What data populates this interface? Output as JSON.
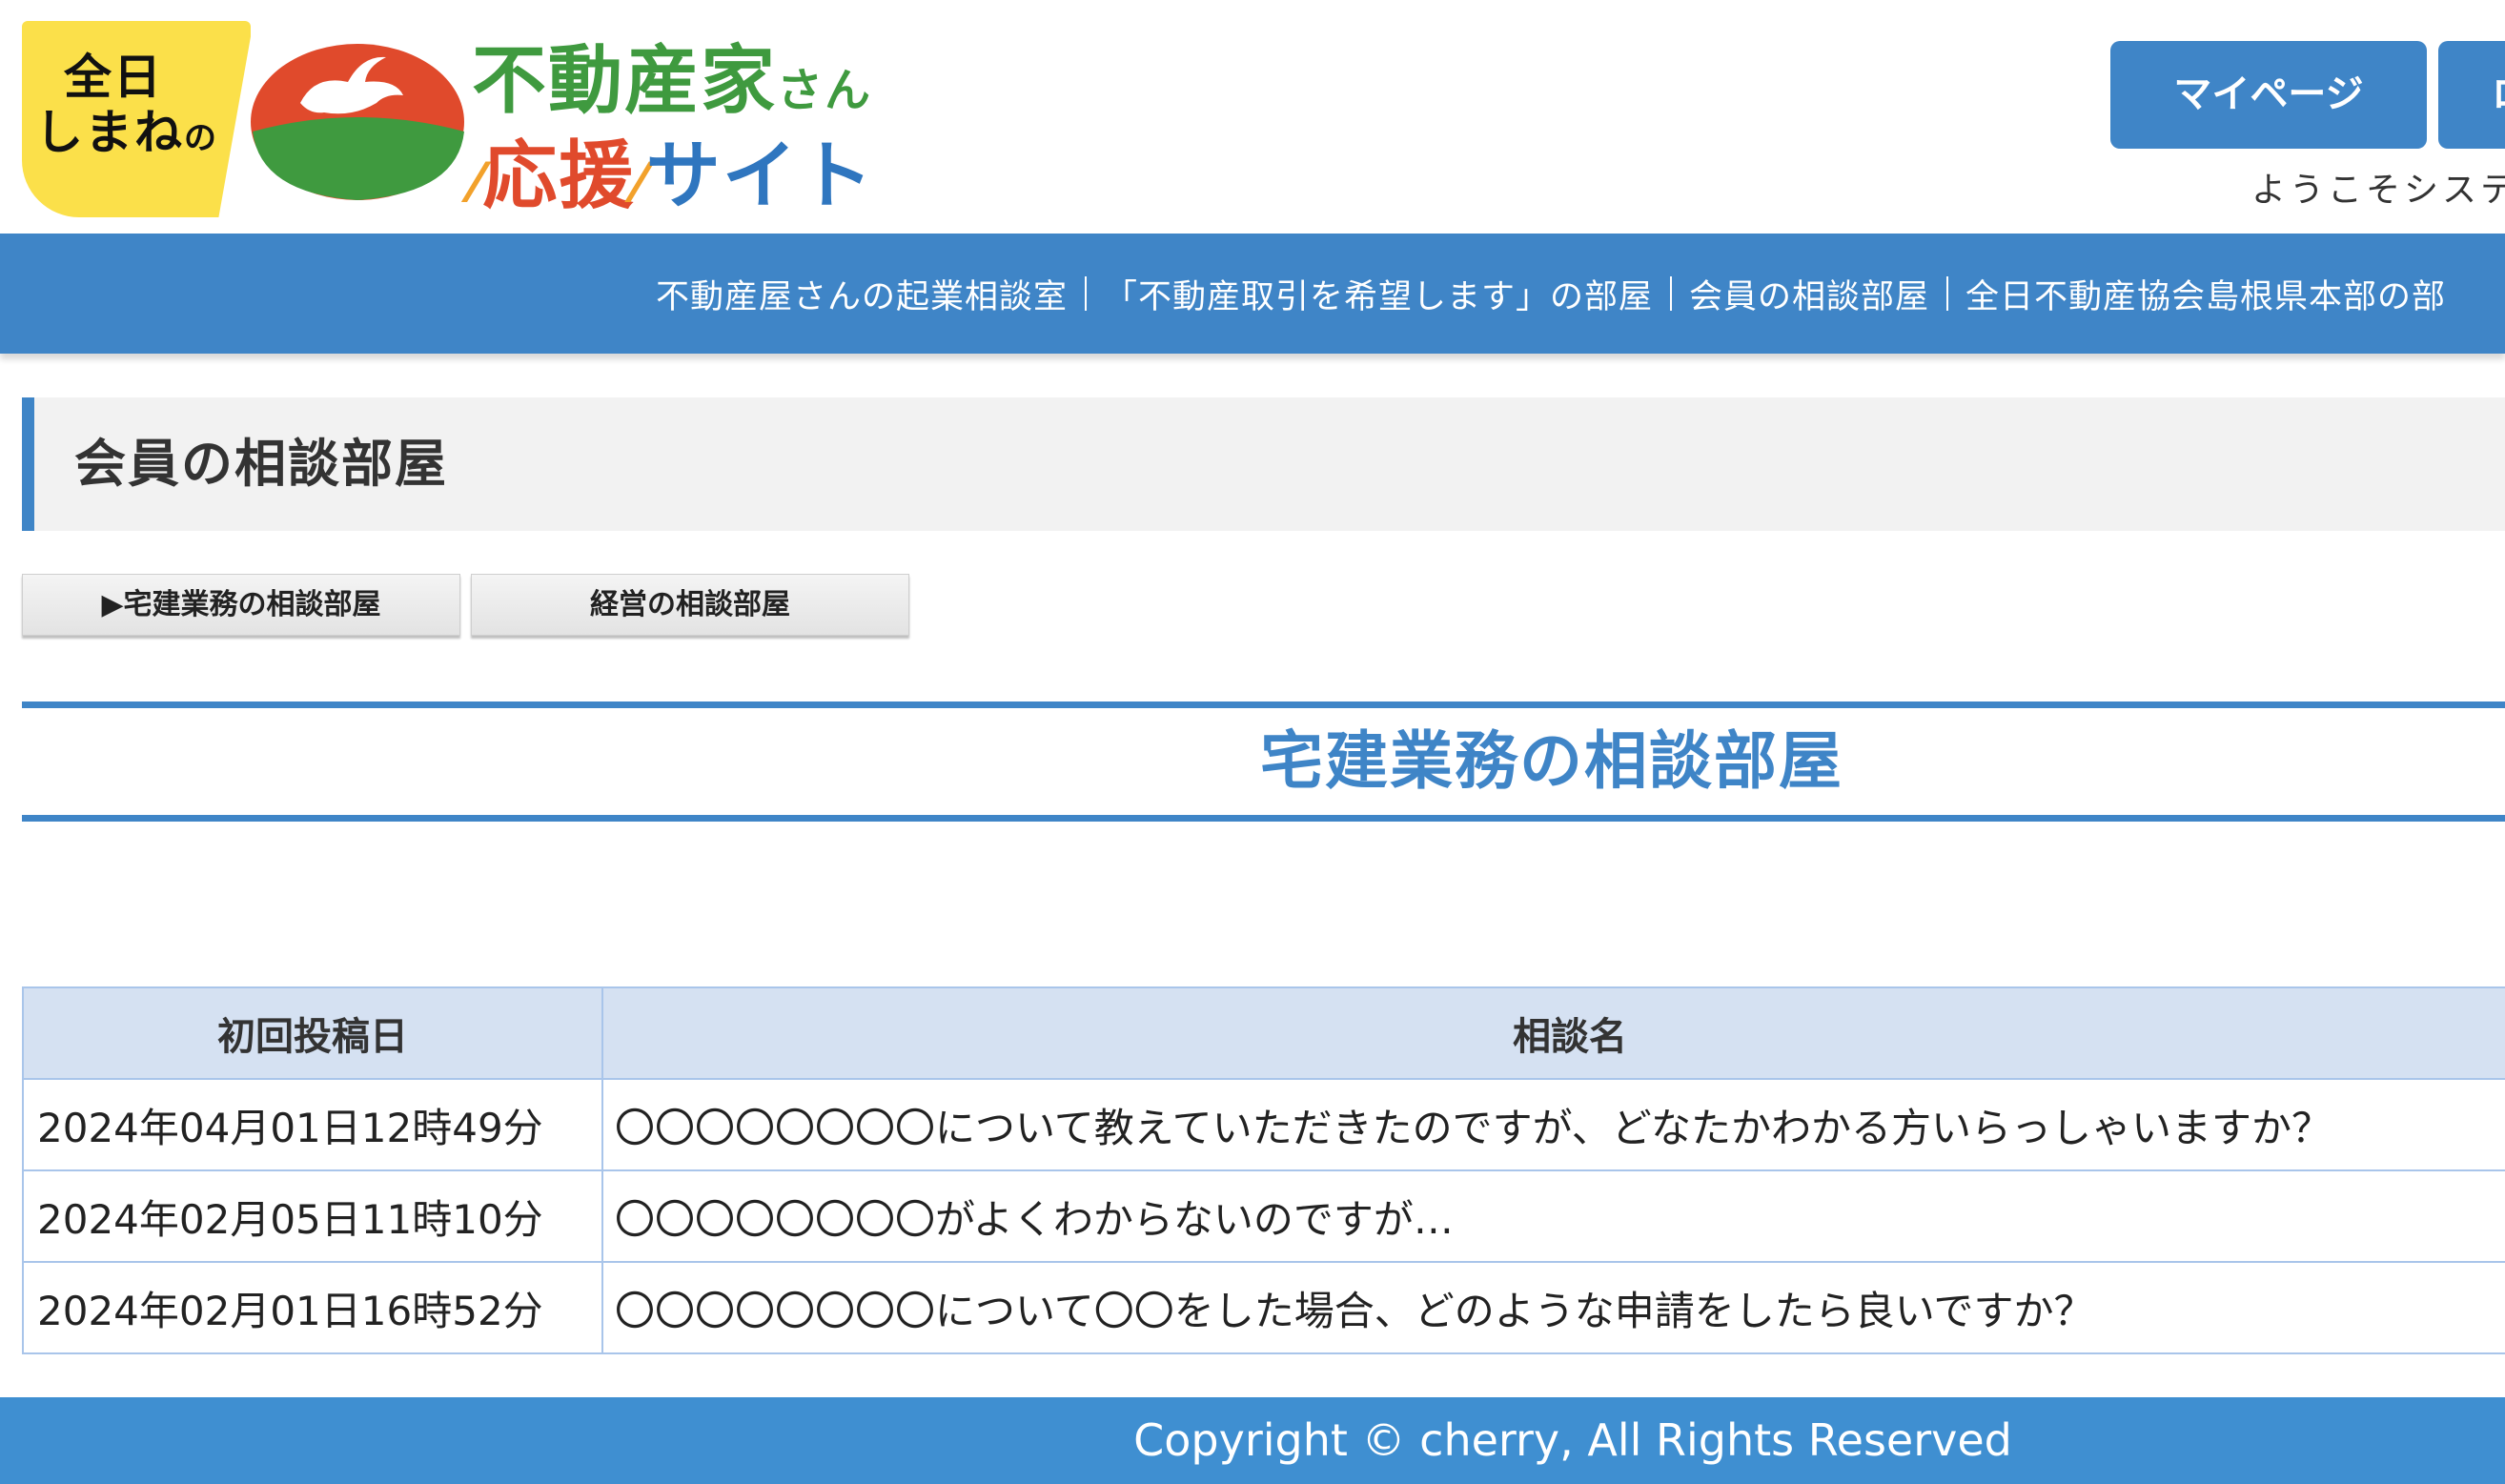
{
  "logo": {
    "badge_line1": "全日",
    "badge_line2": "しまね",
    "badge_small": "の",
    "line1": "不動産家",
    "line1_small": "さん",
    "line2_a": "応援",
    "line2_b": "サイト"
  },
  "header": {
    "mypage_label": "マイページ",
    "second_button_label": "ロ",
    "welcome_text": "ようこそシステ"
  },
  "nav": {
    "items": [
      "不動産屋さんの起業相談室",
      "「不動産取引を希望します」の部屋",
      "会員の相談部屋",
      "全日不動産協会島根県本部の部"
    ]
  },
  "page": {
    "title": "会員の相談部屋"
  },
  "tabs": [
    {
      "label": "▶宅建業務の相談部屋",
      "active": true
    },
    {
      "label": "経営の相談部屋",
      "active": false
    }
  ],
  "section": {
    "title": "宅建業務の相談部屋"
  },
  "table": {
    "headers": [
      "初回投稿日",
      "相談名"
    ],
    "rows": [
      {
        "date": "2024年04月01日12時49分",
        "title": "〇〇〇〇〇〇〇〇について教えていただきたのですが、どなたかわかる方いらっしゃいますか？"
      },
      {
        "date": "2024年02月05日11時10分",
        "title": "〇〇〇〇〇〇〇〇がよくわからないのですが…"
      },
      {
        "date": "2024年02月01日16時52分",
        "title": "〇〇〇〇〇〇〇〇について〇〇をした場合、どのような申請をしたら良いですか？"
      }
    ]
  },
  "footer": {
    "copyright": "Copyright © cherry, All Rights Reserved"
  },
  "colors": {
    "brand_blue": "#3f85c7",
    "table_header_bg": "#d5e1f2",
    "table_border": "#a9c5ea",
    "logo_yellow": "#fbe04a",
    "logo_green": "#3f9a3f",
    "logo_red": "#e04a2c"
  },
  "icons": {
    "logo_mark": "rabbit-moon-logo-icon"
  }
}
